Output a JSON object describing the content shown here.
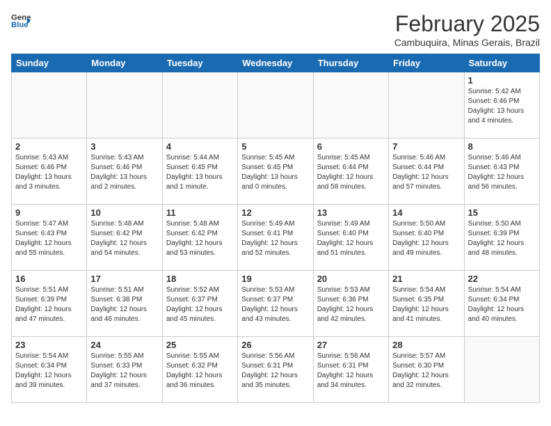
{
  "header": {
    "logo_line1": "General",
    "logo_line2": "Blue",
    "month_year": "February 2025",
    "location": "Cambuquira, Minas Gerais, Brazil"
  },
  "days_of_week": [
    "Sunday",
    "Monday",
    "Tuesday",
    "Wednesday",
    "Thursday",
    "Friday",
    "Saturday"
  ],
  "weeks": [
    [
      {
        "day": "",
        "info": ""
      },
      {
        "day": "",
        "info": ""
      },
      {
        "day": "",
        "info": ""
      },
      {
        "day": "",
        "info": ""
      },
      {
        "day": "",
        "info": ""
      },
      {
        "day": "",
        "info": ""
      },
      {
        "day": "1",
        "info": "Sunrise: 5:42 AM\nSunset: 6:46 PM\nDaylight: 13 hours\nand 4 minutes."
      }
    ],
    [
      {
        "day": "2",
        "info": "Sunrise: 5:43 AM\nSunset: 6:46 PM\nDaylight: 13 hours\nand 3 minutes."
      },
      {
        "day": "3",
        "info": "Sunrise: 5:43 AM\nSunset: 6:46 PM\nDaylight: 13 hours\nand 2 minutes."
      },
      {
        "day": "4",
        "info": "Sunrise: 5:44 AM\nSunset: 6:45 PM\nDaylight: 13 hours\nand 1 minute."
      },
      {
        "day": "5",
        "info": "Sunrise: 5:45 AM\nSunset: 6:45 PM\nDaylight: 13 hours\nand 0 minutes."
      },
      {
        "day": "6",
        "info": "Sunrise: 5:45 AM\nSunset: 6:44 PM\nDaylight: 12 hours\nand 58 minutes."
      },
      {
        "day": "7",
        "info": "Sunrise: 5:46 AM\nSunset: 6:44 PM\nDaylight: 12 hours\nand 57 minutes."
      },
      {
        "day": "8",
        "info": "Sunrise: 5:46 AM\nSunset: 6:43 PM\nDaylight: 12 hours\nand 56 minutes."
      }
    ],
    [
      {
        "day": "9",
        "info": "Sunrise: 5:47 AM\nSunset: 6:43 PM\nDaylight: 12 hours\nand 55 minutes."
      },
      {
        "day": "10",
        "info": "Sunrise: 5:48 AM\nSunset: 6:42 PM\nDaylight: 12 hours\nand 54 minutes."
      },
      {
        "day": "11",
        "info": "Sunrise: 5:48 AM\nSunset: 6:42 PM\nDaylight: 12 hours\nand 53 minutes."
      },
      {
        "day": "12",
        "info": "Sunrise: 5:49 AM\nSunset: 6:41 PM\nDaylight: 12 hours\nand 52 minutes."
      },
      {
        "day": "13",
        "info": "Sunrise: 5:49 AM\nSunset: 6:40 PM\nDaylight: 12 hours\nand 51 minutes."
      },
      {
        "day": "14",
        "info": "Sunrise: 5:50 AM\nSunset: 6:40 PM\nDaylight: 12 hours\nand 49 minutes."
      },
      {
        "day": "15",
        "info": "Sunrise: 5:50 AM\nSunset: 6:39 PM\nDaylight: 12 hours\nand 48 minutes."
      }
    ],
    [
      {
        "day": "16",
        "info": "Sunrise: 5:51 AM\nSunset: 6:39 PM\nDaylight: 12 hours\nand 47 minutes."
      },
      {
        "day": "17",
        "info": "Sunrise: 5:51 AM\nSunset: 6:38 PM\nDaylight: 12 hours\nand 46 minutes."
      },
      {
        "day": "18",
        "info": "Sunrise: 5:52 AM\nSunset: 6:37 PM\nDaylight: 12 hours\nand 45 minutes."
      },
      {
        "day": "19",
        "info": "Sunrise: 5:53 AM\nSunset: 6:37 PM\nDaylight: 12 hours\nand 43 minutes."
      },
      {
        "day": "20",
        "info": "Sunrise: 5:53 AM\nSunset: 6:36 PM\nDaylight: 12 hours\nand 42 minutes."
      },
      {
        "day": "21",
        "info": "Sunrise: 5:54 AM\nSunset: 6:35 PM\nDaylight: 12 hours\nand 41 minutes."
      },
      {
        "day": "22",
        "info": "Sunrise: 5:54 AM\nSunset: 6:34 PM\nDaylight: 12 hours\nand 40 minutes."
      }
    ],
    [
      {
        "day": "23",
        "info": "Sunrise: 5:54 AM\nSunset: 6:34 PM\nDaylight: 12 hours\nand 39 minutes."
      },
      {
        "day": "24",
        "info": "Sunrise: 5:55 AM\nSunset: 6:33 PM\nDaylight: 12 hours\nand 37 minutes."
      },
      {
        "day": "25",
        "info": "Sunrise: 5:55 AM\nSunset: 6:32 PM\nDaylight: 12 hours\nand 36 minutes."
      },
      {
        "day": "26",
        "info": "Sunrise: 5:56 AM\nSunset: 6:31 PM\nDaylight: 12 hours\nand 35 minutes."
      },
      {
        "day": "27",
        "info": "Sunrise: 5:56 AM\nSunset: 6:31 PM\nDaylight: 12 hours\nand 34 minutes."
      },
      {
        "day": "28",
        "info": "Sunrise: 5:57 AM\nSunset: 6:30 PM\nDaylight: 12 hours\nand 32 minutes."
      },
      {
        "day": "",
        "info": ""
      }
    ]
  ]
}
